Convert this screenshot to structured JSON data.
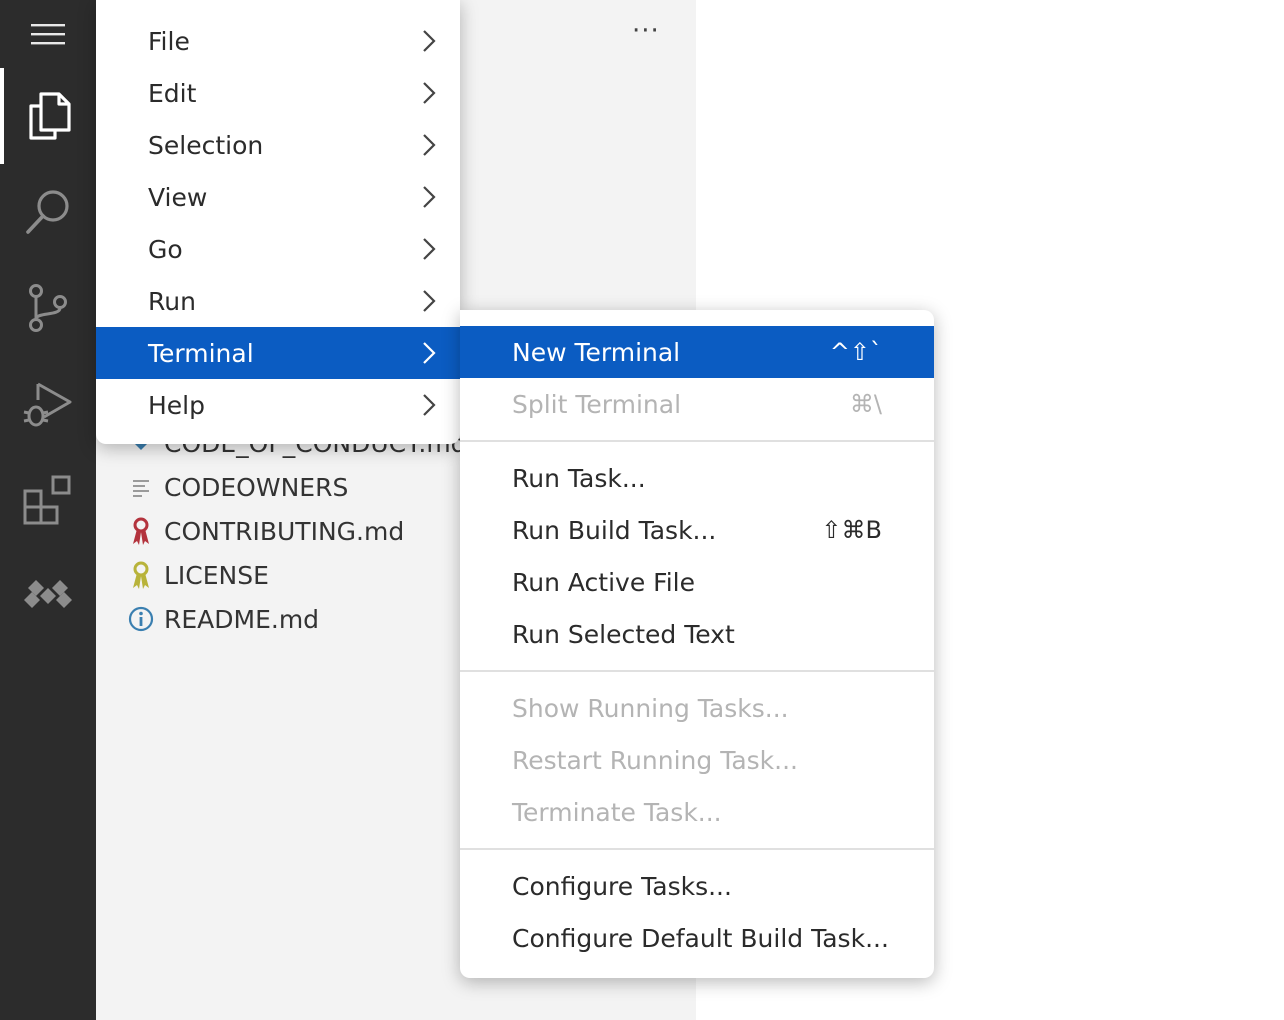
{
  "sidebar": {
    "more_label": "···",
    "files": [
      {
        "name": "CODE_OF_CONDUCT.md",
        "icon": "markdown-icon"
      },
      {
        "name": "CODEOWNERS",
        "icon": "text-lines-icon"
      },
      {
        "name": "CONTRIBUTING.md",
        "icon": "ribbon-red-icon"
      },
      {
        "name": "LICENSE",
        "icon": "ribbon-yellow-icon"
      },
      {
        "name": "README.md",
        "icon": "info-icon"
      }
    ]
  },
  "main_menu": {
    "items": [
      {
        "label": "File"
      },
      {
        "label": "Edit"
      },
      {
        "label": "Selection"
      },
      {
        "label": "View"
      },
      {
        "label": "Go"
      },
      {
        "label": "Run"
      },
      {
        "label": "Terminal",
        "selected": true
      },
      {
        "label": "Help"
      }
    ]
  },
  "terminal_menu": {
    "items": [
      {
        "label": "New Terminal",
        "shortcut": "^⇧`",
        "selected": true
      },
      {
        "label": "Split Terminal",
        "shortcut": "⌘\\",
        "disabled": true
      },
      {
        "label": "Run Task..."
      },
      {
        "label": "Run Build Task...",
        "shortcut": "⇧⌘B"
      },
      {
        "label": "Run Active File"
      },
      {
        "label": "Run Selected Text"
      },
      {
        "label": "Show Running Tasks...",
        "disabled": true
      },
      {
        "label": "Restart Running Task...",
        "disabled": true
      },
      {
        "label": "Terminate Task...",
        "disabled": true
      },
      {
        "label": "Configure Tasks..."
      },
      {
        "label": "Configure Default Build Task..."
      }
    ]
  },
  "colors": {
    "activity_bar": "#2c2c2c",
    "sidebar": "#f3f3f3",
    "selection": "#0b5cc2",
    "disabled_text": "#b4b4b4"
  }
}
